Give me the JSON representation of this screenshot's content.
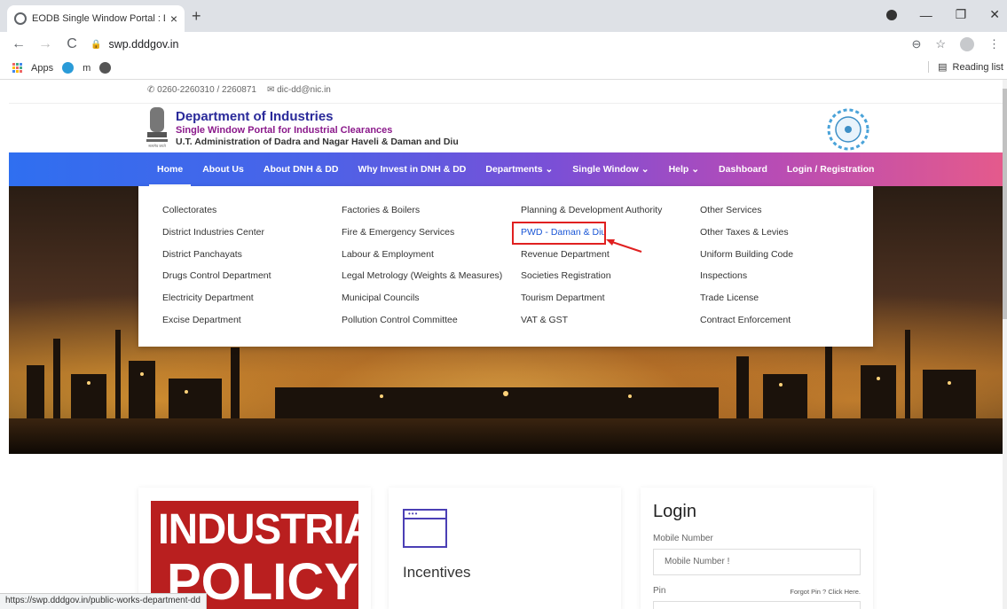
{
  "browser": {
    "tab_title": "EODB Single Window Portal : Da",
    "tab_close": "×",
    "new_tab": "+",
    "url": "swp.dddgov.in",
    "bookmarks": {
      "apps_label": "Apps",
      "m_label": "m"
    },
    "reading_list": "Reading list",
    "status_url": "https://swp.dddgov.in/public-works-department-dd"
  },
  "site": {
    "phone": "0260-2260310 / 2260871",
    "email": "dic-dd@nic.in",
    "dept_title": "Department of Industries",
    "dept_subtitle": "Single Window Portal for Industrial Clearances",
    "dept_admin": "U.T. Administration of Dadra and Nagar Haveli & Daman and Diu",
    "emblem_caption": "सत्यमेव जयते"
  },
  "menu": [
    {
      "label": "Home",
      "active": true
    },
    {
      "label": "About Us"
    },
    {
      "label": "About DNH & DD"
    },
    {
      "label": "Why Invest in DNH & DD"
    },
    {
      "label": "Departments ⌄"
    },
    {
      "label": "Single Window ⌄"
    },
    {
      "label": "Help ⌄"
    },
    {
      "label": "Dashboard"
    },
    {
      "label": "Login / Registration"
    }
  ],
  "departments": {
    "col1": [
      "Collectorates",
      "District Industries Center",
      "District Panchayats",
      "Drugs Control Department",
      "Electricity Department",
      "Excise Department"
    ],
    "col2": [
      "Factories & Boilers",
      "Fire & Emergency Services",
      "Labour & Employment",
      "Legal Metrology (Weights & Measures)",
      "Municipal Councils",
      "Pollution Control Committee"
    ],
    "col3": [
      "Planning & Development Authority",
      "PWD - Daman & Diu",
      "Revenue Department",
      "Societies Registration",
      "Tourism Department",
      "VAT & GST"
    ],
    "col4": [
      "Other Services",
      "Other Taxes & Levies",
      "Uniform Building Code",
      "Inspections",
      "Trade License",
      "Contract Enforcement"
    ]
  },
  "cards": {
    "policy_line1": "INDUSTRIAL",
    "policy_line2": "POLICY",
    "incentives_title": "Incentives",
    "login_title": "Login",
    "mobile_label": "Mobile Number",
    "mobile_placeholder": "Mobile Number !",
    "pin_label": "Pin",
    "forgot_pin": "Forgot Pin ? Click Here."
  },
  "colors": {
    "menu_gradient_start": "#2f6ff0",
    "menu_gradient_end": "#e45a8c",
    "highlight_box": "#e02020",
    "link_blue": "#1a56d6"
  }
}
